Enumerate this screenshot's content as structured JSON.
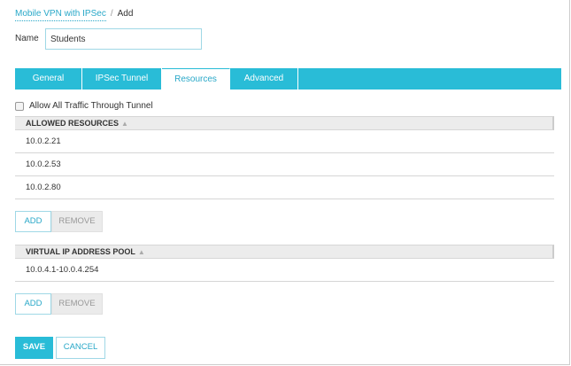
{
  "breadcrumb": {
    "parent": "Mobile VPN with IPSec",
    "separator": "/",
    "current": "Add"
  },
  "name": {
    "label": "Name",
    "value": "Students"
  },
  "tabs": [
    {
      "label": "General"
    },
    {
      "label": "IPSec Tunnel"
    },
    {
      "label": "Resources",
      "active": true
    },
    {
      "label": "Advanced"
    }
  ],
  "allow_all": {
    "label": "Allow All Traffic Through Tunnel",
    "checked": false
  },
  "allowed_resources": {
    "header": "ALLOWED RESOURCES",
    "sort_icon": "sort-icon",
    "rows": [
      "10.0.2.21",
      "10.0.2.53",
      "10.0.2.80"
    ],
    "add": "ADD",
    "remove": "REMOVE"
  },
  "pool": {
    "header": "VIRTUAL IP ADDRESS POOL",
    "rows": [
      "10.0.4.1-10.0.4.254"
    ],
    "add": "ADD",
    "remove": "REMOVE"
  },
  "footer": {
    "save": "SAVE",
    "cancel": "CANCEL"
  },
  "colors": {
    "accent": "#29bcd7"
  }
}
